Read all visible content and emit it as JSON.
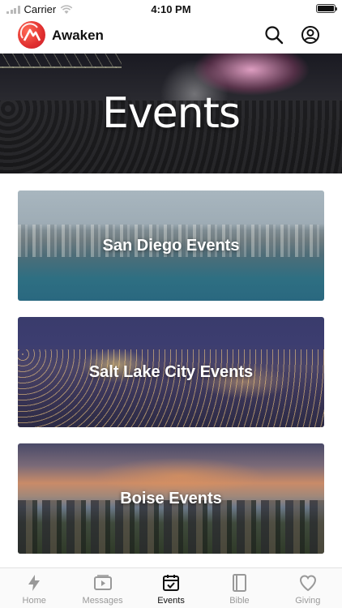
{
  "status_bar": {
    "carrier": "Carrier",
    "time": "4:10 PM"
  },
  "header": {
    "title": "Awaken",
    "logo_icon": "awaken-logo-icon",
    "actions": [
      {
        "name": "search-icon"
      },
      {
        "name": "account-icon"
      }
    ]
  },
  "hero": {
    "title": "Events"
  },
  "events": [
    {
      "label": "San Diego Events"
    },
    {
      "label": "Salt Lake City Events"
    },
    {
      "label": "Boise Events"
    }
  ],
  "tabs": [
    {
      "label": "Home",
      "icon": "lightning-icon",
      "active": false
    },
    {
      "label": "Messages",
      "icon": "video-player-icon",
      "active": false
    },
    {
      "label": "Events",
      "icon": "calendar-check-icon",
      "active": true
    },
    {
      "label": "Bible",
      "icon": "book-icon",
      "active": false
    },
    {
      "label": "Giving",
      "icon": "heart-icon",
      "active": false
    }
  ],
  "colors": {
    "brand": "#e0322f",
    "active_tab": "#111111",
    "inactive_tab": "#999999"
  }
}
